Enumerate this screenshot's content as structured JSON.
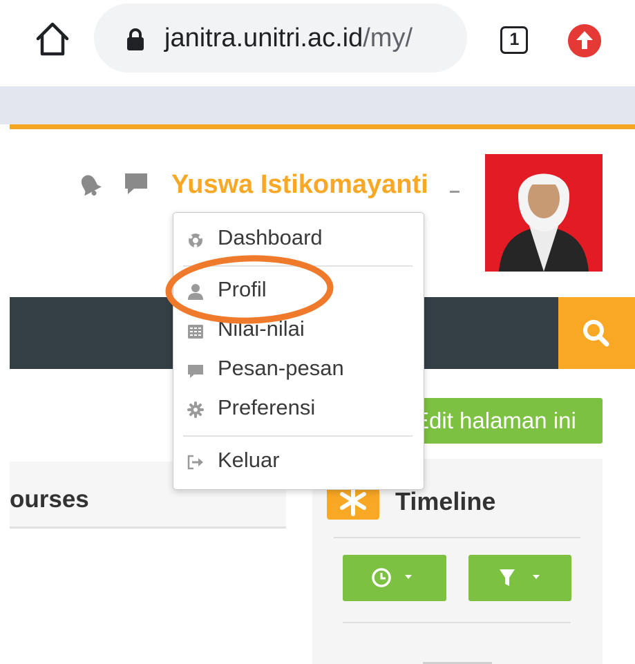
{
  "browser": {
    "url_host": "janitra.unitri.ac.id",
    "url_path": "/my/",
    "tab_count": "1"
  },
  "header": {
    "user_name": "Yuswa Istikomayanti"
  },
  "user_menu": {
    "items": [
      {
        "label": "Dashboard",
        "icon": "dashboard-icon"
      },
      {
        "label": "Profil",
        "icon": "user-icon"
      },
      {
        "label": "Nilai-nilai",
        "icon": "grades-icon"
      },
      {
        "label": "Pesan-pesan",
        "icon": "message-icon"
      },
      {
        "label": "Preferensi",
        "icon": "gear-icon"
      },
      {
        "label": "Keluar",
        "icon": "logout-icon"
      }
    ],
    "highlighted_item": "Profil"
  },
  "main": {
    "edit_button_label": "Edit halaman ini",
    "courses_title": "ourses",
    "timeline_title": "Timeline"
  },
  "colors": {
    "accent_orange": "#f9a825",
    "green": "#7cc142",
    "navbar": "#333f44",
    "annotation_ring": "#f07a2c"
  }
}
